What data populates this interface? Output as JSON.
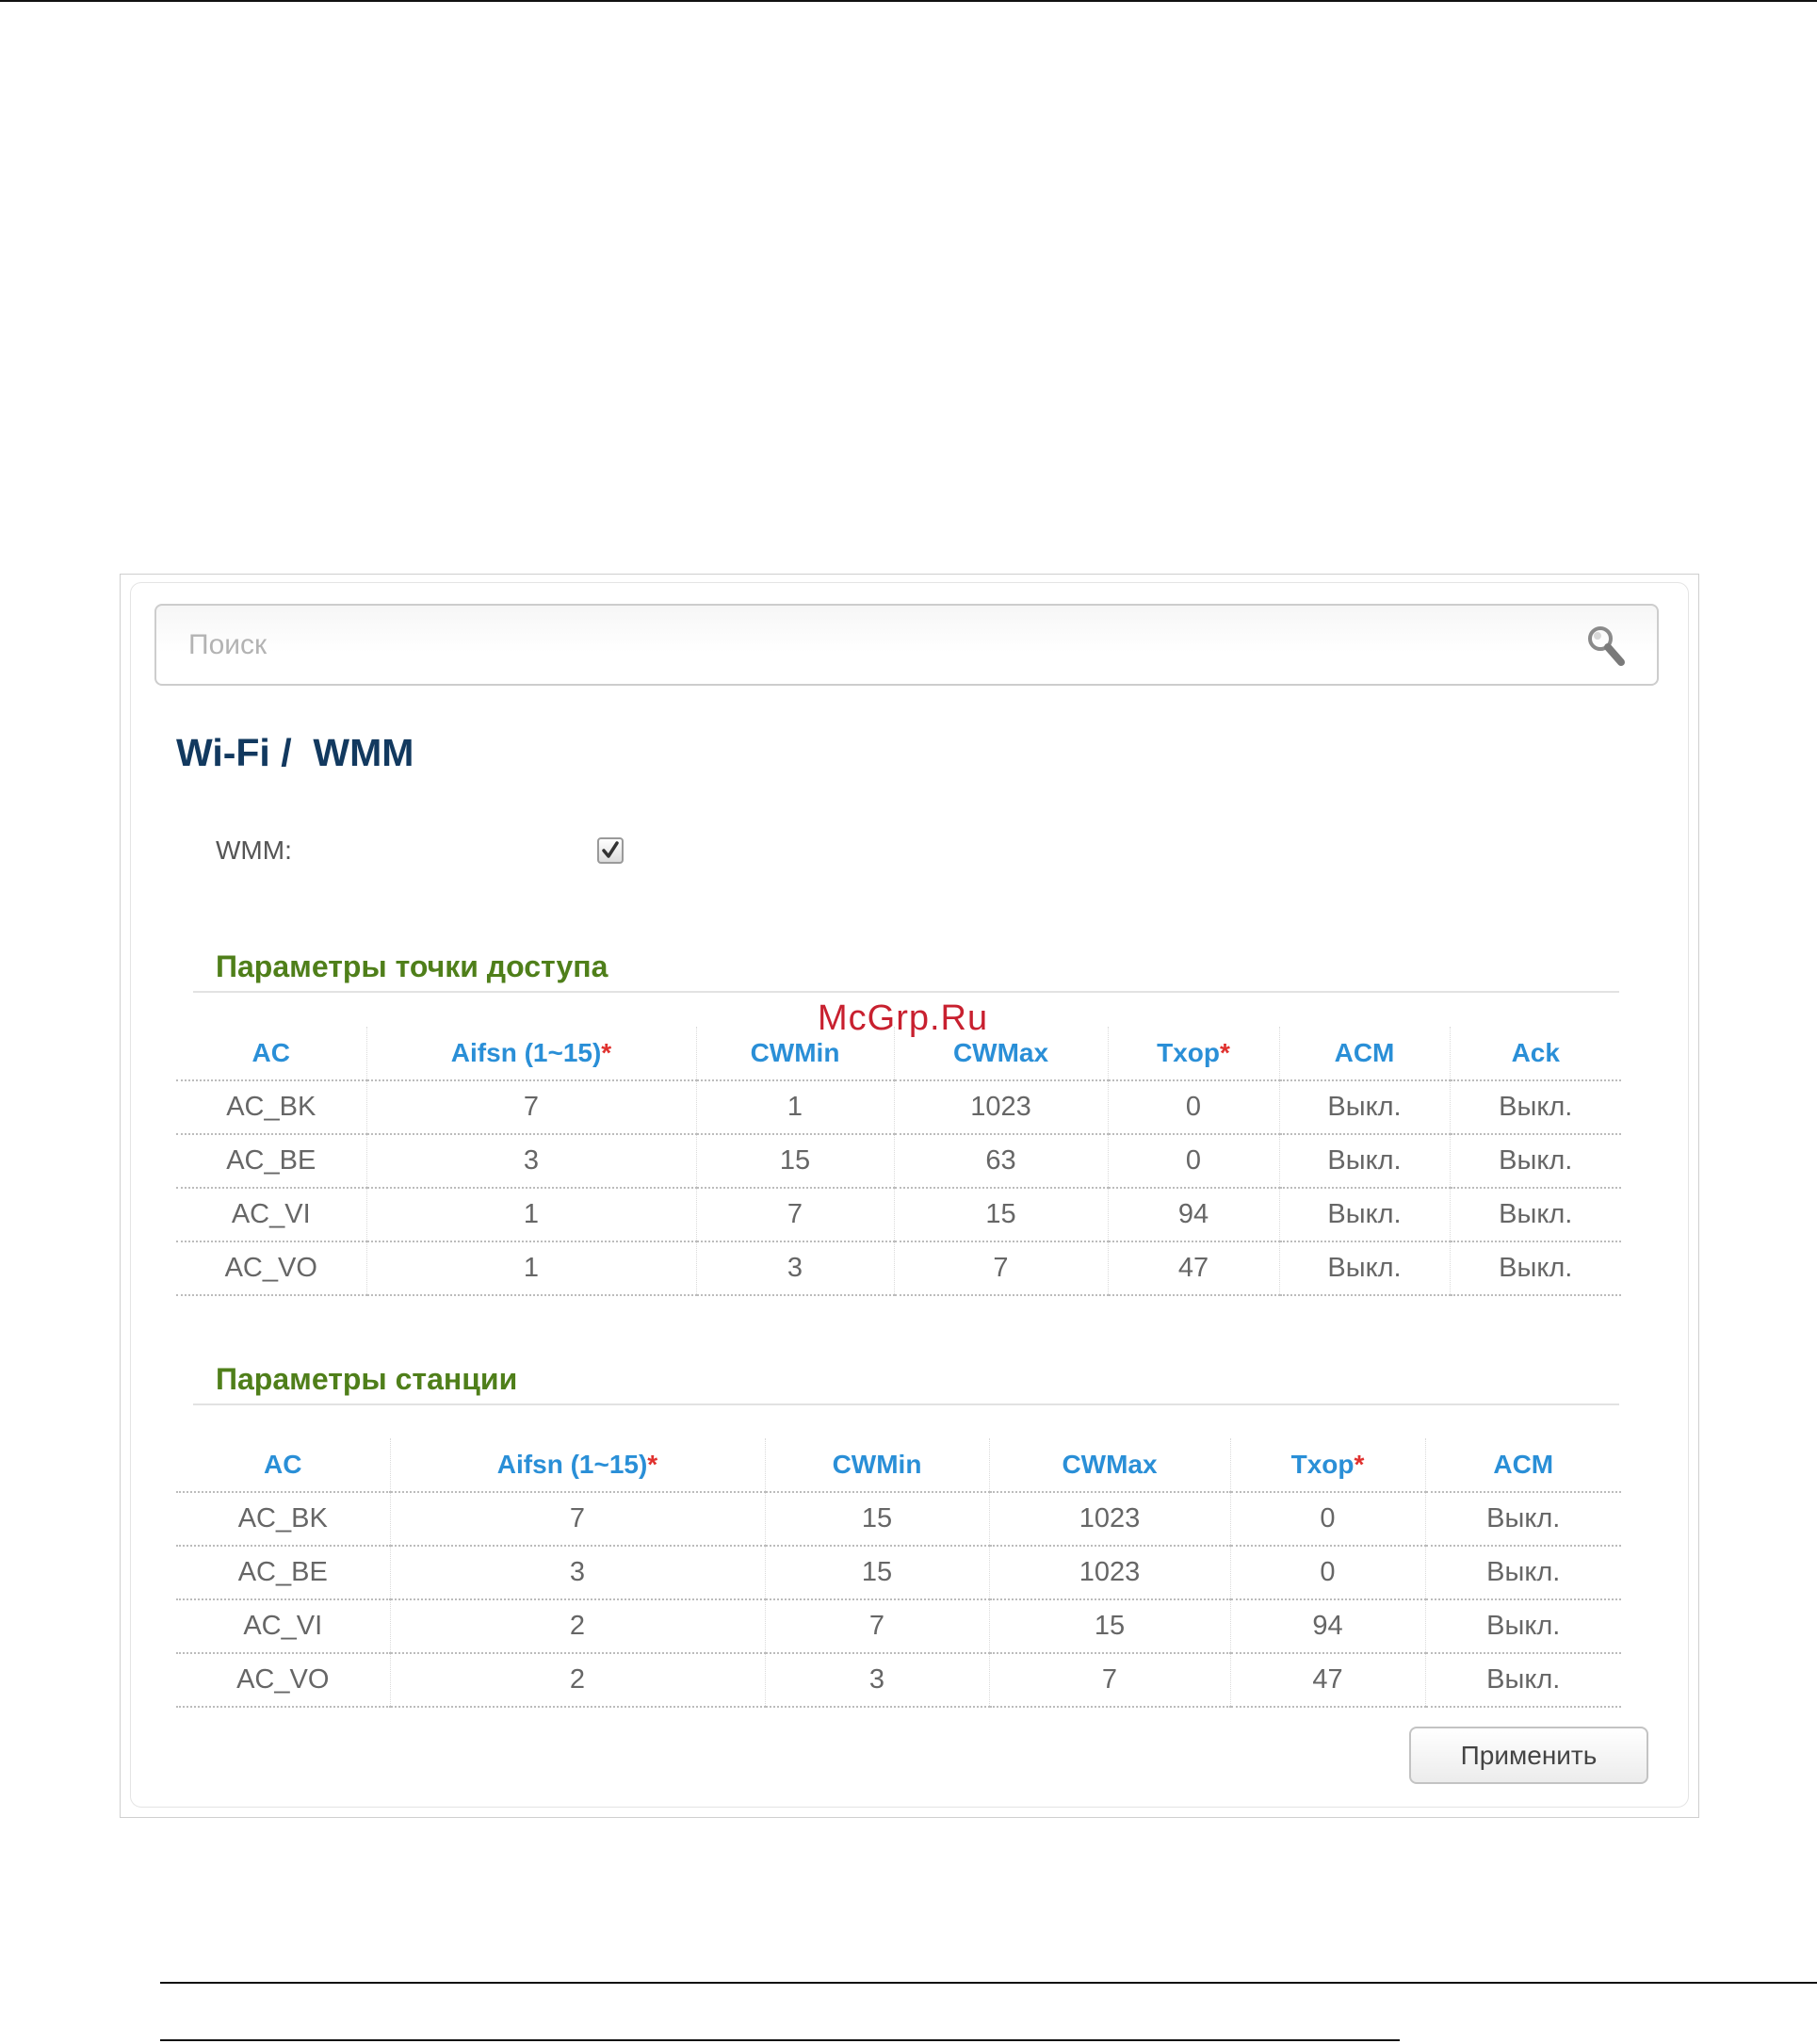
{
  "search": {
    "placeholder": "Поиск"
  },
  "page": {
    "title": "Wi-Fi /  WMM"
  },
  "wmm": {
    "label": "WMM:",
    "enabled": true
  },
  "watermark": "McGrp.Ru",
  "ap_params": {
    "title": "Параметры точки доступа",
    "columns": [
      {
        "label": "AC",
        "required": false
      },
      {
        "label": "Aifsn (1~15)",
        "required": true
      },
      {
        "label": "CWMin",
        "required": false
      },
      {
        "label": "CWMax",
        "required": false
      },
      {
        "label": "Txop",
        "required": true
      },
      {
        "label": "ACM",
        "required": false
      },
      {
        "label": "Ack",
        "required": false
      }
    ],
    "rows": [
      [
        "AC_BK",
        "7",
        "1",
        "1023",
        "0",
        "Выкл.",
        "Выкл."
      ],
      [
        "AC_BE",
        "3",
        "15",
        "63",
        "0",
        "Выкл.",
        "Выкл."
      ],
      [
        "AC_VI",
        "1",
        "7",
        "15",
        "94",
        "Выкл.",
        "Выкл."
      ],
      [
        "AC_VO",
        "1",
        "3",
        "7",
        "47",
        "Выкл.",
        "Выкл."
      ]
    ]
  },
  "station_params": {
    "title": "Параметры станции",
    "columns": [
      {
        "label": "AC",
        "required": false
      },
      {
        "label": "Aifsn (1~15)",
        "required": true
      },
      {
        "label": "CWMin",
        "required": false
      },
      {
        "label": "CWMax",
        "required": false
      },
      {
        "label": "Txop",
        "required": true
      },
      {
        "label": "ACM",
        "required": false
      }
    ],
    "rows": [
      [
        "AC_BK",
        "7",
        "15",
        "1023",
        "0",
        "Выкл."
      ],
      [
        "AC_BE",
        "3",
        "15",
        "1023",
        "0",
        "Выкл."
      ],
      [
        "AC_VI",
        "2",
        "7",
        "15",
        "94",
        "Выкл."
      ],
      [
        "AC_VO",
        "2",
        "3",
        "7",
        "47",
        "Выкл."
      ]
    ]
  },
  "required_marker": "*",
  "actions": {
    "apply_label": "Применить"
  },
  "icons": {
    "search": "search-icon",
    "checkbox": "checkmark-icon"
  },
  "colors": {
    "title": "#12395f",
    "section_title": "#4f7f1a",
    "table_header": "#2a8fd7",
    "required_asterisk": "#e0312e",
    "watermark": "#c8202f"
  }
}
